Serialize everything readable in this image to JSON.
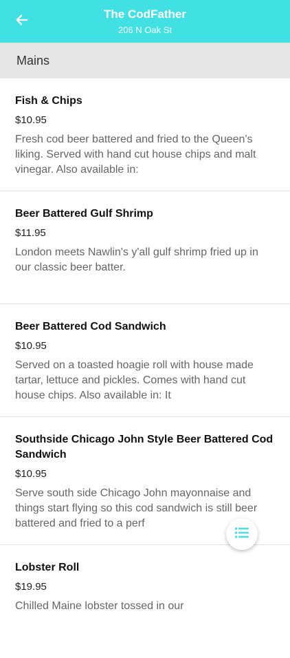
{
  "header": {
    "title": "The CodFather",
    "subtitle": "206 N Oak St",
    "back_icon": "arrow-left-icon",
    "background_color": "#41e1e3"
  },
  "section": {
    "label": "Mains"
  },
  "items": [
    {
      "name": "Fish & Chips",
      "price": "$10.95",
      "description": "Fresh cod beer battered and fried to the Queen's liking. Served with hand cut house chips and malt vinegar. Also available in:"
    },
    {
      "name": "Beer Battered Gulf Shrimp",
      "price": "$11.95",
      "description": "London meets Nawlin's y'all gulf shrimp fried up in our classic beer batter."
    },
    {
      "name": "Beer Battered Cod Sandwich",
      "price": "$10.95",
      "description": "Served on a toasted hoagie roll with house made tartar, lettuce and pickles. Comes with hand cut house chips. Also available in: It"
    },
    {
      "name": "Southside Chicago John Style Beer Battered Cod Sandwich",
      "price": "$10.95",
      "description": "Serve south side Chicago John mayonnaise and things start flying so this cod sandwich is still beer battered and fried to a perf"
    },
    {
      "name": "Lobster Roll",
      "price": "$19.95",
      "description": "Chilled Maine lobster tossed in our"
    }
  ],
  "fab": {
    "icon": "list-icon",
    "accent_color": "#41e1e3"
  }
}
